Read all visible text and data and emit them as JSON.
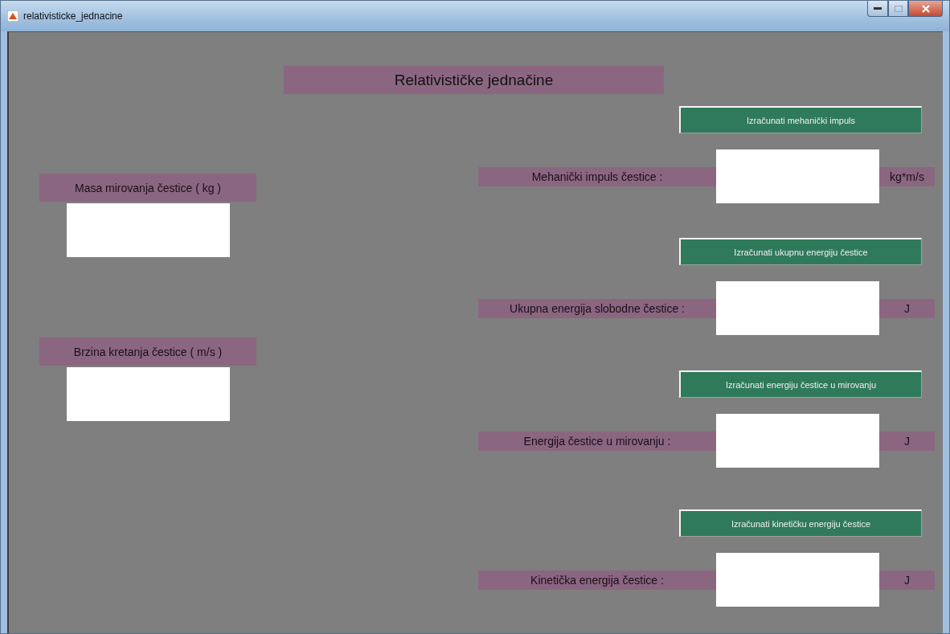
{
  "window": {
    "title": "relativisticke_jednacine"
  },
  "heading": "Relativističke jednačine",
  "inputs": [
    {
      "label": "Masa mirovanja čestice ( kg )"
    },
    {
      "label": "Brzina kretanja čestice ( m/s )"
    }
  ],
  "outputs": [
    {
      "button": "Izračunati mehanički impuls",
      "label": "Mehanički impuls čestice :",
      "unit": "kg*m/s"
    },
    {
      "button": "Izračunati ukupnu energiju čestice",
      "label": "Ukupna energija slobodne čestice :",
      "unit": "J"
    },
    {
      "button": "Izračunati energiju čestice u mirovanju",
      "label": "Energija čestice u mirovanju :",
      "unit": "J"
    },
    {
      "button": "Izračunati kinetičku energiju čestice",
      "label": "Kinetička energija čestice :",
      "unit": "J"
    }
  ]
}
